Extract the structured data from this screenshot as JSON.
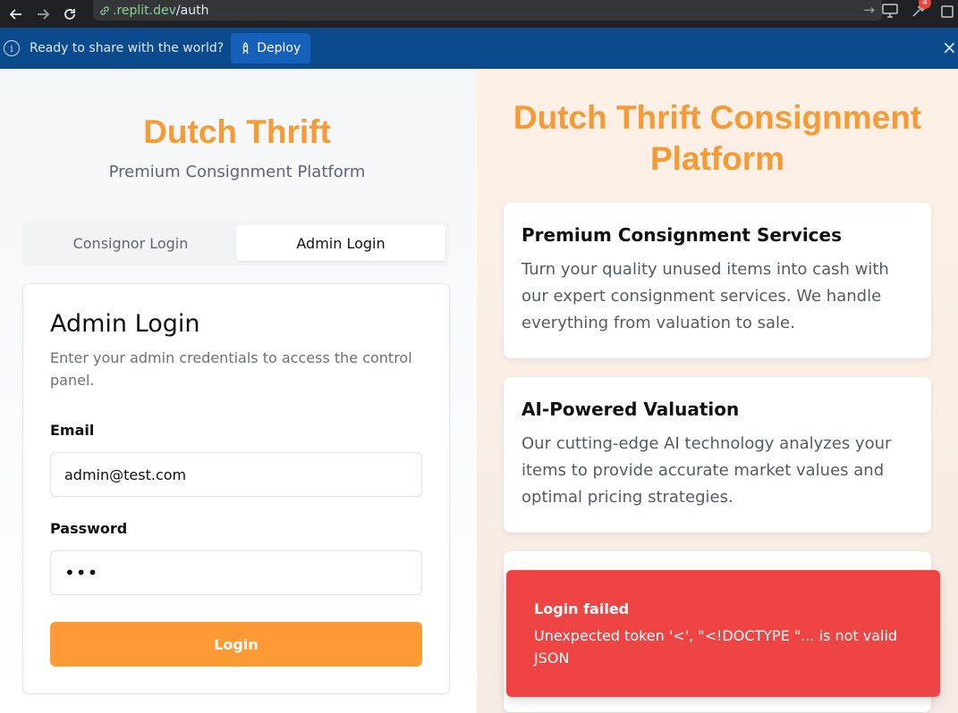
{
  "browser": {
    "url_host": ".replit.dev",
    "url_path": "/auth",
    "notification_count": "4"
  },
  "banner": {
    "text": "Ready to share with the world?",
    "deploy_label": "Deploy",
    "close_glyph": "×"
  },
  "left": {
    "brand_title": "Dutch Thrift",
    "brand_subtitle": "Premium Consignment Platform",
    "tabs": [
      {
        "label": "Consignor Login",
        "active": false
      },
      {
        "label": "Admin Login",
        "active": true
      }
    ],
    "card": {
      "title": "Admin Login",
      "description": "Enter your admin credentials to access the control panel.",
      "email_label": "Email",
      "email_value": "admin@test.com",
      "password_label": "Password",
      "password_value": "•••",
      "login_label": "Login"
    }
  },
  "right": {
    "title": "Dutch Thrift Consignment Platform",
    "features": [
      {
        "title": "Premium Consignment Services",
        "text": "Turn your quality unused items into cash with our expert consignment services. We handle everything from valuation to sale."
      },
      {
        "title": "AI-Powered Valuation",
        "text": "Our cutting-edge AI technology analyzes your items to provide accurate market values and optimal pricing strategies."
      }
    ]
  },
  "toast": {
    "title": "Login failed",
    "message": "Unexpected token '<', \"<!DOCTYPE \"... is not valid JSON"
  },
  "colors": {
    "brand_orange": "#f59a35",
    "button_orange": "#fd9a33",
    "banner_blue": "#0b4a8c",
    "error_red": "#ef4444"
  }
}
